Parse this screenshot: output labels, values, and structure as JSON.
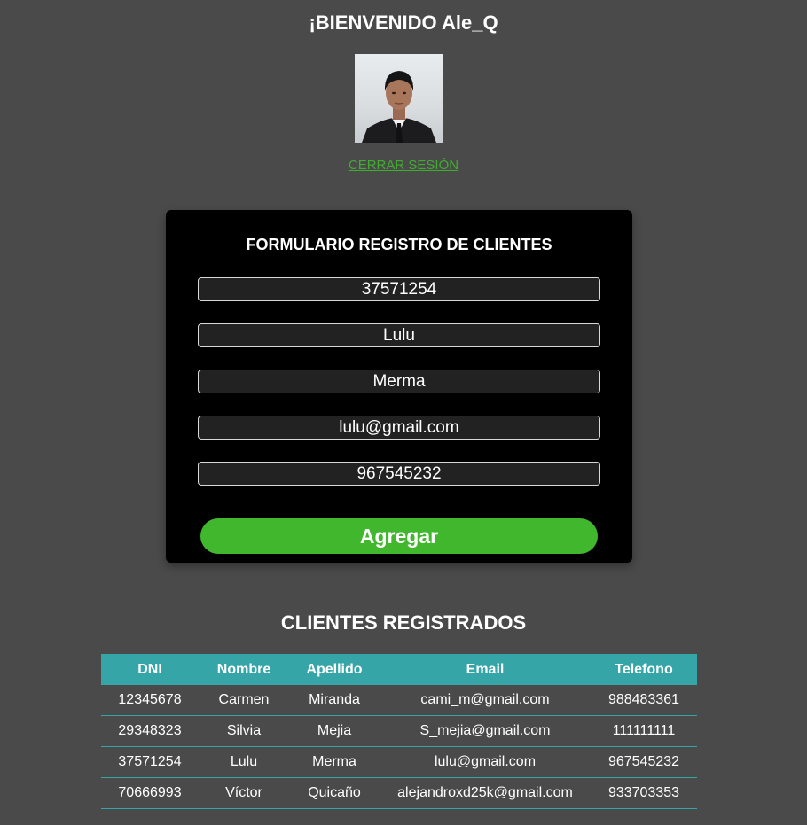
{
  "header": {
    "welcome": "¡BIENVENIDO Ale_Q",
    "logout_label": "CERRAR SESIÓN"
  },
  "form": {
    "title": "FORMULARIO REGISTRO DE CLIENTES",
    "fields": {
      "dni": "37571254",
      "nombre": "Lulu",
      "apellido": "Merma",
      "email": "lulu@gmail.com",
      "telefono": "967545232"
    },
    "submit_label": "Agregar"
  },
  "clients": {
    "title": "CLIENTES REGISTRADOS",
    "columns": [
      "DNI",
      "Nombre",
      "Apellido",
      "Email",
      "Telefono"
    ],
    "rows": [
      [
        "12345678",
        "Carmen",
        "Miranda",
        "cami_m@gmail.com",
        "988483361"
      ],
      [
        "29348323",
        "Silvia",
        "Mejia",
        "S_mejia@gmail.com",
        "111111111"
      ],
      [
        "37571254",
        "Lulu",
        "Merma",
        "lulu@gmail.com",
        "967545232"
      ],
      [
        "70666993",
        "Víctor",
        "Quicaño",
        "alejandroxd25k@gmail.com",
        "933703353"
      ]
    ]
  },
  "colors": {
    "page_background": "#4a4a4a",
    "accent_green": "#41b72d",
    "link_green": "#3fae2f",
    "table_header_teal": "#35a5a8"
  }
}
